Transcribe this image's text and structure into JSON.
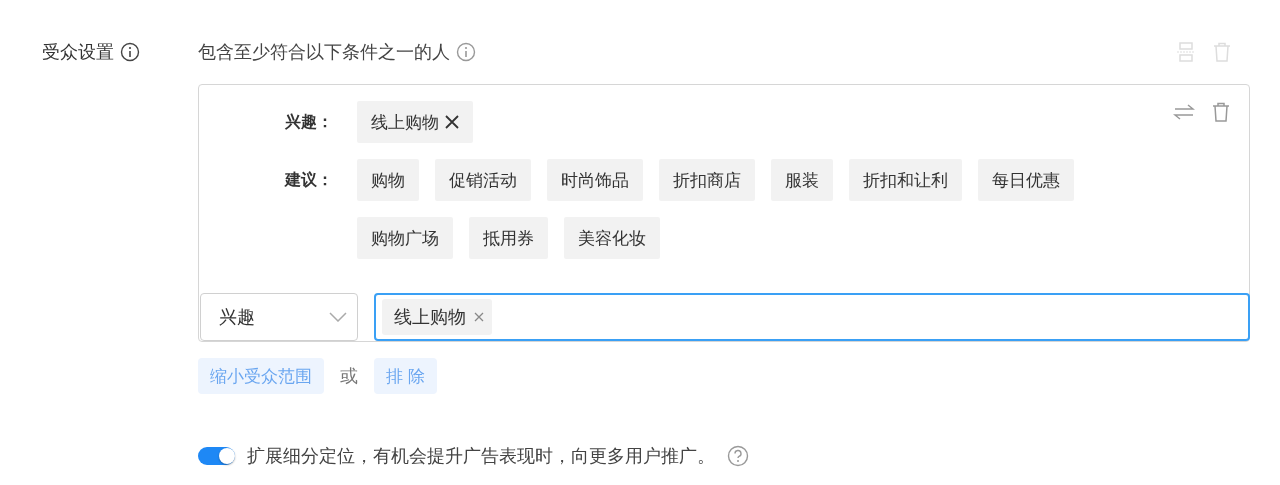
{
  "section_label": "受众设置",
  "heading": "包含至少符合以下条件之一的人",
  "criteria": {
    "selected_label": "兴趣：",
    "selected_tags": [
      "线上购物"
    ],
    "suggestion_label": "建议：",
    "suggestions": [
      "购物",
      "促销活动",
      "时尚饰品",
      "折扣商店",
      "服装",
      "折扣和让利",
      "每日优惠",
      "购物广场",
      "抵用券",
      "美容化妆"
    ],
    "type_select": {
      "value": "兴趣"
    },
    "input_tags": [
      "线上购物"
    ]
  },
  "actions": {
    "narrow": "缩小受众范围",
    "or": "或",
    "exclude": "排 除"
  },
  "expand": {
    "on": true,
    "text": "扩展细分定位，有机会提升广告表现时，向更多用户推广。"
  }
}
